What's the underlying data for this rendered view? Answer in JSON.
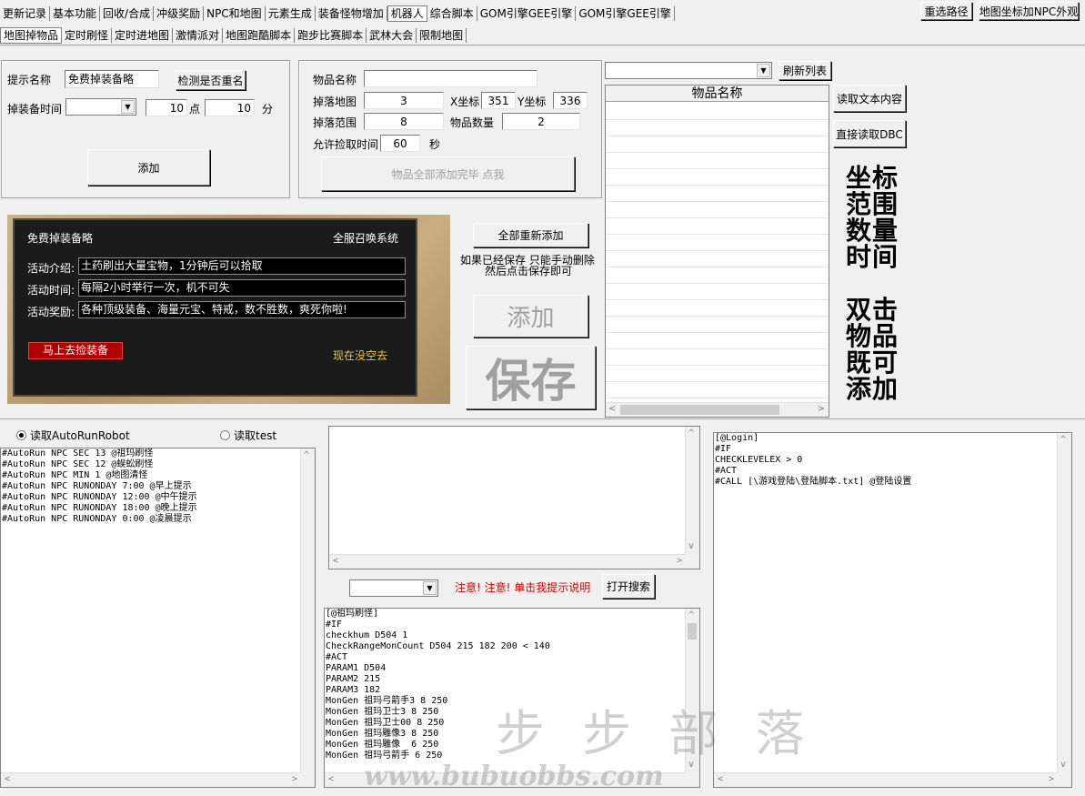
{
  "top_tabs": [
    "更新记录",
    "基本功能",
    "回收/合成",
    "冲级奖励",
    "NPC和地图",
    "元素生成",
    "装备怪物增加",
    "机器人",
    "综合脚本",
    "GOM引擎GEE引擎",
    "GOM引擎GEE引擎"
  ],
  "top_buttons": {
    "reselect_path": "重选路径",
    "map_coord_npc": "地图坐标加NPC外观"
  },
  "sub_tabs": [
    "地图掉物品",
    "定时刷怪",
    "定时进地图",
    "激情派对",
    "地图跑酷脚本",
    "跑步比赛脚本",
    "武林大会",
    "限制地图"
  ],
  "left_panel": {
    "prompt_label": "提示名称",
    "prompt_value": "免费掉装备略",
    "check_button": "检测是否重名",
    "drop_time_label": "掉装备时间",
    "hour_value": "10",
    "hour_unit": "点",
    "minute_value": "10",
    "minute_unit": "分",
    "add_button": "添加"
  },
  "item_panel": {
    "item_name_label": "物品名称",
    "item_name_value": "",
    "drop_map_label": "掉落地图",
    "drop_map_value": "3",
    "x_label": "X坐标",
    "x_value": "351",
    "y_label": "Y坐标",
    "y_value": "336",
    "range_label": "掉落范围",
    "range_value": "8",
    "qty_label": "物品数量",
    "qty_value": "2",
    "pick_time_label": "允许捡取时间",
    "pick_time_value": "60",
    "pick_time_unit": "秒",
    "done_button": "物品全部添加完毕 点我"
  },
  "list_panel": {
    "refresh_button": "刷新列表",
    "column_header": "物品名称",
    "read_text_button": "读取文本内容",
    "read_dbc_button": "直接读取DBC"
  },
  "hint_big": {
    "line1": "坐标",
    "line2": "范围",
    "line3": "数量",
    "line4": "时间",
    "line5": "双击",
    "line6": "物品",
    "line7": "既可",
    "line8": "添加"
  },
  "promo": {
    "title": "免费掉装备略",
    "system": "全服召唤系统",
    "intro_label": "活动介绍:",
    "intro_value": "土药刷出大量宝物，1分钟后可以拾取",
    "time_label": "活动时间:",
    "time_value": "每隔2小时举行一次，机不可失",
    "reward_label": "活动奖励:",
    "reward_value": "各种顶级装备、海量元宝、特戒，数不胜数，爽死你啦!",
    "go_button": "马上去捡装备",
    "busy_text": "现在没空去"
  },
  "middle_actions": {
    "readd_all": "全部重新添加",
    "note_line1": "如果已经保存 只能手动删除",
    "note_line2": "然后点击保存即可",
    "add_big": "添加",
    "save_big": "保存"
  },
  "bottom_left": {
    "radio1": "读取AutoRunRobot",
    "radio2": "读取test",
    "lines": [
      "#AutoRun NPC SEC 13 @祖玛刷怪",
      "#AutoRun NPC SEC 12 @蜈蚣刷怪",
      "#AutoRun NPC MIN 1 @地图清怪",
      "#AutoRun NPC RUNONDAY 7:00 @早上提示",
      "#AutoRun NPC RUNONDAY 12:00 @中午提示",
      "#AutoRun NPC RUNONDAY 18:00 @晚上提示",
      "#AutoRun NPC RUNONDAY 0:00 @凌晨提示"
    ]
  },
  "bottom_middle": {
    "notice": "注意! 注意! 单击我提示说明",
    "open_search": "打开搜索",
    "lines": [
      "[@祖玛刷怪]",
      "#IF",
      "checkhum D504 1",
      "CheckRangeMonCount D504 215 182 200 < 140",
      "#ACT",
      "PARAM1 D504",
      "PARAM2 215",
      "PARAM3 182",
      "MonGen 祖玛弓箭手3 8 250",
      "MonGen 祖玛卫士3 8 250",
      "MonGen 祖玛卫士00 8 250",
      "MonGen 祖玛雕像3 8 250",
      "MonGen 祖玛雕像  6 250",
      "MonGen 祖玛弓箭手 6 250"
    ]
  },
  "bottom_right": {
    "lines": [
      "[@Login]",
      "#IF",
      "CHECKLEVELEX > 0",
      "#ACT",
      "#CALL [\\游戏登陆\\登陆脚本.txt] @登陆设置"
    ]
  },
  "watermark": "www.bubuobbs.com",
  "colors": {
    "notice_red": "#d00000",
    "promo_button": "#c00000",
    "busy_yellow": "#e8c44a"
  }
}
